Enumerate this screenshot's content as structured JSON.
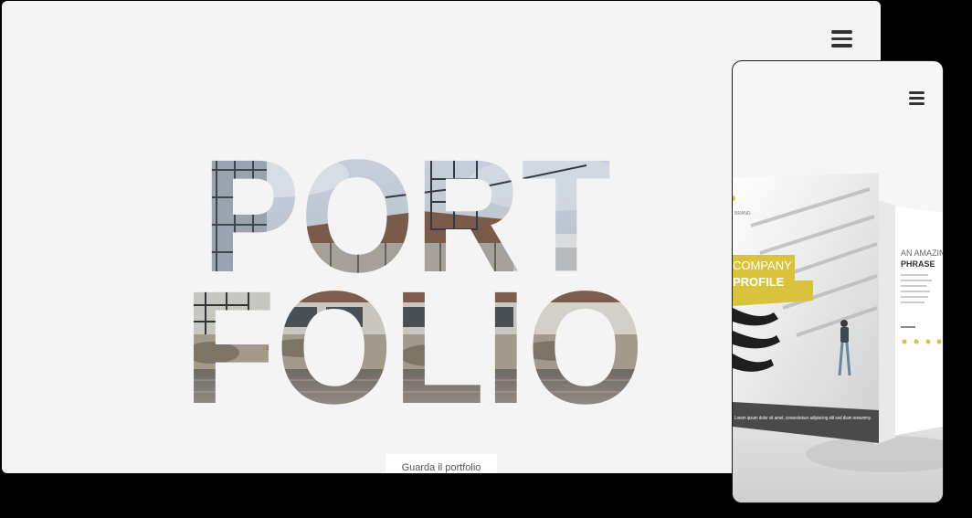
{
  "desktop": {
    "hero_title_line1": "PORT",
    "hero_title_line2": "FOLIO",
    "cta_label": "Guarda il portfolio",
    "menu_icon": "hamburger-menu-icon"
  },
  "mobile": {
    "menu_icon": "hamburger-menu-icon",
    "brochure": {
      "brand": "BRAND",
      "cover_title_line1": "COMPANY",
      "cover_title_line2": "PROFILE",
      "cover_body": "Lorem ipsum dolor sit amet, consectetuer adipiscing elit sed diam nonummy.",
      "inner_heading_line1": "AN AMAZING",
      "inner_heading_line2": "PHRASE",
      "accent_color": "#d8c33a"
    }
  },
  "colors": {
    "page_background": "#000000",
    "desktop_background": "#f4f4f4",
    "icon_color": "#333333",
    "accent": "#d8c33a"
  }
}
